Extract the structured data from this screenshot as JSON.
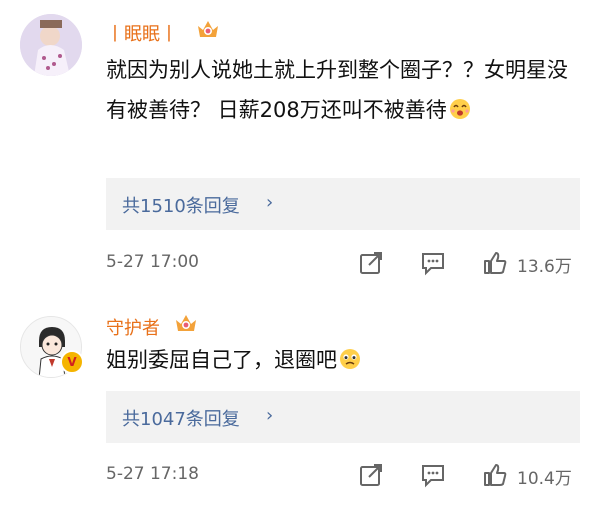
{
  "comments": [
    {
      "username": "丨眠眠丨",
      "text": "就因为别人说她土就上升到整个圈子？？女明星没有被善待？ 日薪208万还叫不被善待",
      "reply_count_label": "共1510条回复",
      "reply_chevron": "›",
      "timestamp": "5-27 17:00",
      "like_count": "13.6万",
      "verified_badge": "",
      "icons": [
        "avatar",
        "crown-badge-icon",
        "laughing-emoji-icon",
        "share-icon",
        "comment-icon",
        "like-icon"
      ]
    },
    {
      "username": "守护者",
      "text": "姐别委屈自己了，退圈吧",
      "reply_count_label": "共1047条回复",
      "reply_chevron": "›",
      "timestamp": "5-27 17:18",
      "like_count": "10.4万",
      "verified_badge": "V",
      "icons": [
        "avatar",
        "crown-badge-icon",
        "sad-emoji-icon",
        "share-icon",
        "comment-icon",
        "like-icon"
      ]
    }
  ],
  "colors": {
    "username": "#e8711a",
    "reply_link": "#4a6a9c",
    "reply_bg": "#f2f2f2",
    "meta_text": "#666666",
    "verified": "#f5b400"
  }
}
